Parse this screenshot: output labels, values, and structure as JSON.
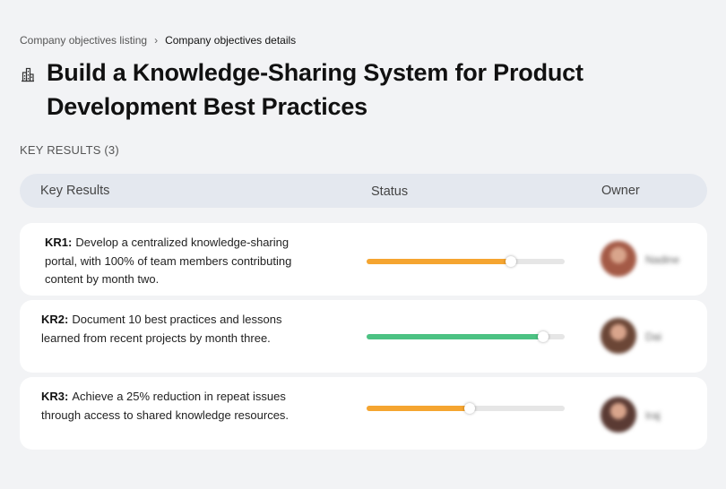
{
  "breadcrumb": {
    "parent": "Company objectives listing",
    "separator": "›",
    "current": "Company objectives details"
  },
  "objective": {
    "icon": "building-icon",
    "title": "Build a Knowledge-Sharing System for Product Development Best Practices"
  },
  "key_results_section": {
    "label": "KEY RESULTS (3)"
  },
  "table": {
    "columns": [
      "Key Results",
      "Status",
      "Owner"
    ],
    "rows": [
      {
        "id": "KR1:",
        "text": "Develop a centralized knowledge-sharing portal, with 100% of team members contributing content by month two.",
        "progress": 0.73,
        "color": "#f5a530",
        "owner": "Nadine",
        "avatar_color": "#a45a46"
      },
      {
        "id": "KR2:",
        "text": "Document 10 best practices and lessons learned from recent projects by month three.",
        "progress": 0.89,
        "color": "#4cc283",
        "owner": "Dai",
        "avatar_color": "#6b4636"
      },
      {
        "id": "KR3:",
        "text": "Achieve a 25% reduction in repeat issues through access to shared knowledge resources.",
        "progress": 0.52,
        "color": "#f5a530",
        "owner": "Iraj",
        "avatar_color": "#5a3a33"
      }
    ]
  }
}
